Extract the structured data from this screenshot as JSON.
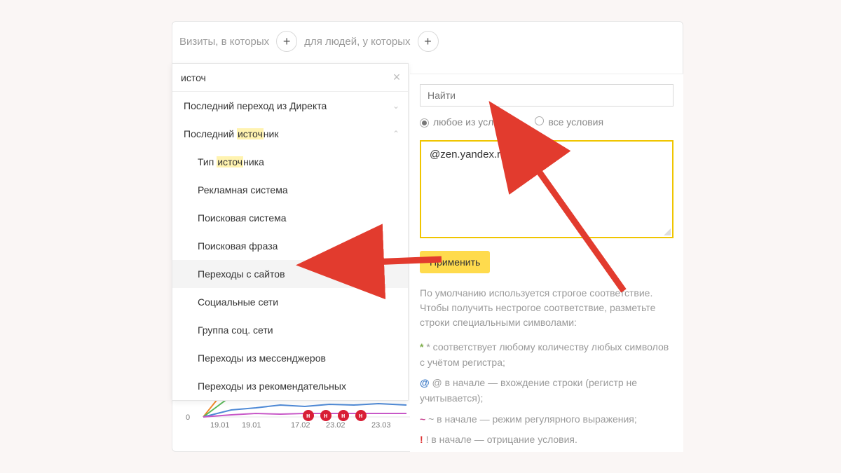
{
  "filterBar": {
    "visitsLabel": "Визиты, в которых",
    "peopleLabel": "для людей, у которых"
  },
  "leftPanel": {
    "searchValue": "источ",
    "categories": {
      "direct": {
        "label_pre": "Последний переход из Директа"
      },
      "last": {
        "label_pre": "Последний ",
        "label_hl": "источ",
        "label_post": "ник"
      }
    },
    "subitems": {
      "type": {
        "pre": "Тип ",
        "hl": "источ",
        "post": "ника"
      },
      "adsys": {
        "label": "Рекламная система"
      },
      "search": {
        "label": "Поисковая система"
      },
      "phrase": {
        "label": "Поисковая фраза"
      },
      "sites": {
        "label": "Переходы с сайтов"
      },
      "social": {
        "label": "Социальные сети"
      },
      "group": {
        "label": "Группа соц. сети"
      },
      "mess": {
        "label": "Переходы из мессенджеров"
      },
      "recom": {
        "label": "Переходы из рекомендательных"
      }
    }
  },
  "rightPanel": {
    "findPlaceholder": "Найти",
    "radioAny": "любое из условий",
    "radioAll": "все условия",
    "textareaValue": "@zen.yandex.ru",
    "applyLabel": "Применить",
    "helpText": "По умолчанию используется строгое соответствие. Чтобы получить нестрогое соответствие, разметьте строки специальными символами:",
    "bulletStar": "* соответствует любому количеству любых символов с учётом регистра;",
    "bulletAt": "@ в начале — вхождение строки (регистр не учитывается);",
    "bulletTilde": "~ в начале — режим регулярного выражения;",
    "bulletExc": "! в начале — отрицание условия."
  },
  "chart": {
    "zeroLabel": "0",
    "ticks": [
      "19.01",
      "19.01",
      "17.02",
      "23.02",
      "23.03"
    ]
  }
}
